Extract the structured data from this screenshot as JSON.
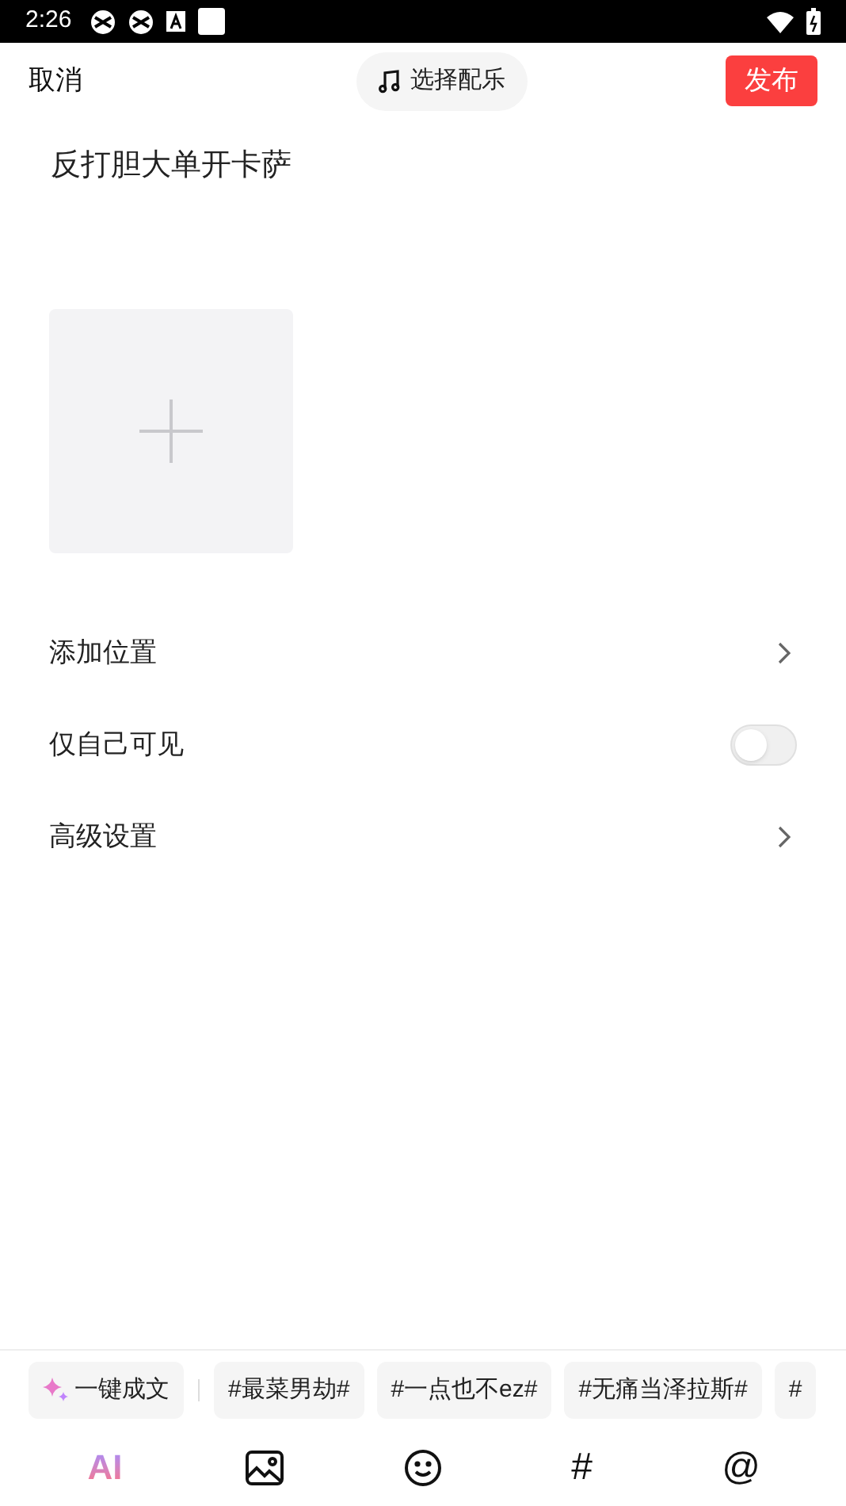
{
  "status_bar": {
    "time": "2:26"
  },
  "header": {
    "cancel": "取消",
    "music": "选择配乐",
    "publish": "发布"
  },
  "post": {
    "text": "反打胆大单开卡萨"
  },
  "settings": [
    {
      "kind": "link",
      "label": "添加位置"
    },
    {
      "kind": "toggle",
      "label": "仅自己可见",
      "on": false
    },
    {
      "kind": "link",
      "label": "高级设置"
    }
  ],
  "suggestions": {
    "ai_button": "一键成文",
    "topics": [
      "#最菜男劫#",
      "#一点也不ez#",
      "#无痛当泽拉斯#",
      "#"
    ]
  },
  "toolbar": [
    {
      "kind": "ai",
      "label": "AI"
    },
    {
      "kind": "image"
    },
    {
      "kind": "emoji"
    },
    {
      "kind": "text",
      "label": "#"
    },
    {
      "kind": "text",
      "label": "@"
    }
  ]
}
